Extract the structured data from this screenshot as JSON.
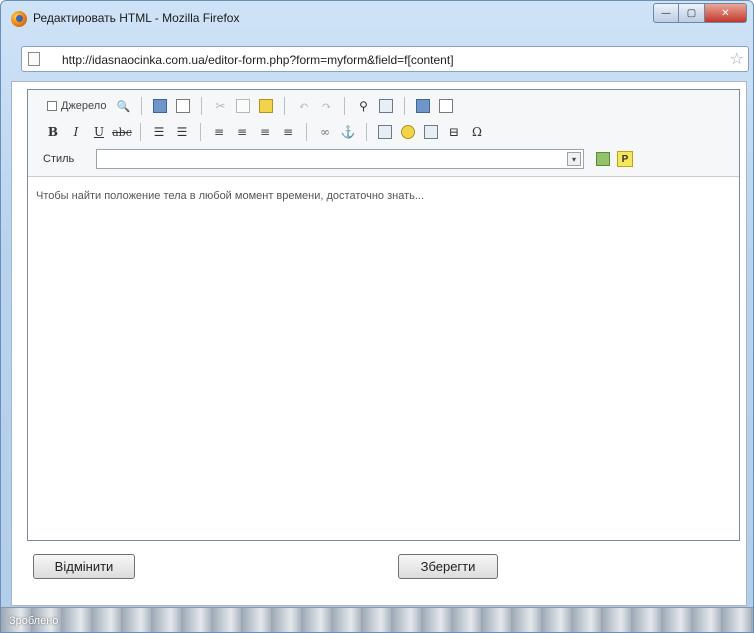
{
  "window": {
    "title": "Редактировать HTML - Mozilla Firefox",
    "minimize_glyph": "—",
    "maximize_glyph": "▢",
    "close_glyph": "✕"
  },
  "urlbar": {
    "url": "http://idasnaocinka.com.ua/editor-form.php?form=myform&field=f[content]",
    "star_glyph": "☆"
  },
  "toolbar": {
    "row1": {
      "source_label": "Джерело",
      "search_glyph": "🔍"
    },
    "row2": {
      "bold": "B",
      "italic": "I",
      "underline": "U",
      "strike": "abc",
      "link_glyph": "∞",
      "omega": "Ω"
    },
    "row3": {
      "style_label": "Стиль",
      "style_value": "",
      "dropdown_glyph": "▾",
      "p_label": "P"
    }
  },
  "editor": {
    "content": "Чтобы найти положение тела в любой момент времени, достаточно знать..."
  },
  "buttons": {
    "cancel": "Відмінити",
    "save": "Зберегти"
  },
  "status": {
    "text": "Зроблено"
  }
}
